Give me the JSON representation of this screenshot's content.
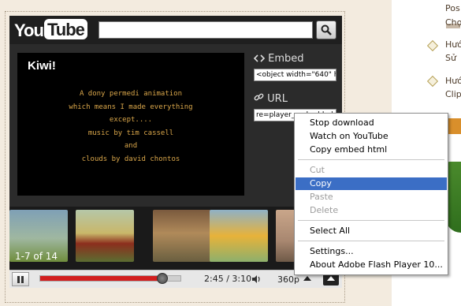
{
  "sidebar_links": [
    {
      "lines": [
        "Pos",
        "Chọ"
      ]
    },
    {
      "lines": [
        "Hướ",
        "Sử"
      ]
    },
    {
      "lines": [
        "Hướ",
        "Clip"
      ]
    }
  ],
  "player": {
    "logo": {
      "you": "You",
      "tube": "Tube"
    },
    "search": {
      "value": ""
    },
    "video": {
      "title": "Kiwi!",
      "credits": [
        "A dony permedi animation",
        "which means I made everything",
        "except....",
        "music by tim cassell",
        "and",
        "clouds by david chontos"
      ]
    },
    "embed": {
      "label": "Embed",
      "value": "<object width=\"640\" h"
    },
    "url": {
      "label": "URL",
      "value": "re=player_embedded"
    },
    "related_counter": "1-7 of 14",
    "controls": {
      "time": "2:45 / 3:10",
      "quality": "360p",
      "progress_fraction": 0.868
    }
  },
  "context_menu": {
    "items": [
      {
        "label": "Stop download",
        "disabled": false
      },
      {
        "label": "Watch on YouTube",
        "disabled": false
      },
      {
        "label": "Copy embed html",
        "disabled": false
      },
      {
        "label": "Cut",
        "disabled": true
      },
      {
        "label": "Copy",
        "disabled": false,
        "highlighted": true
      },
      {
        "label": "Paste",
        "disabled": true
      },
      {
        "label": "Delete",
        "disabled": true
      },
      {
        "label": "Select All",
        "disabled": false
      },
      {
        "label": "Settings...",
        "disabled": false
      },
      {
        "label": "About Adobe Flash Player 10...",
        "disabled": false
      }
    ]
  },
  "colors": {
    "seek_fill": "#d21e1e",
    "menu_highlight": "#3b6ec5",
    "credits_text": "#d9a64a"
  }
}
